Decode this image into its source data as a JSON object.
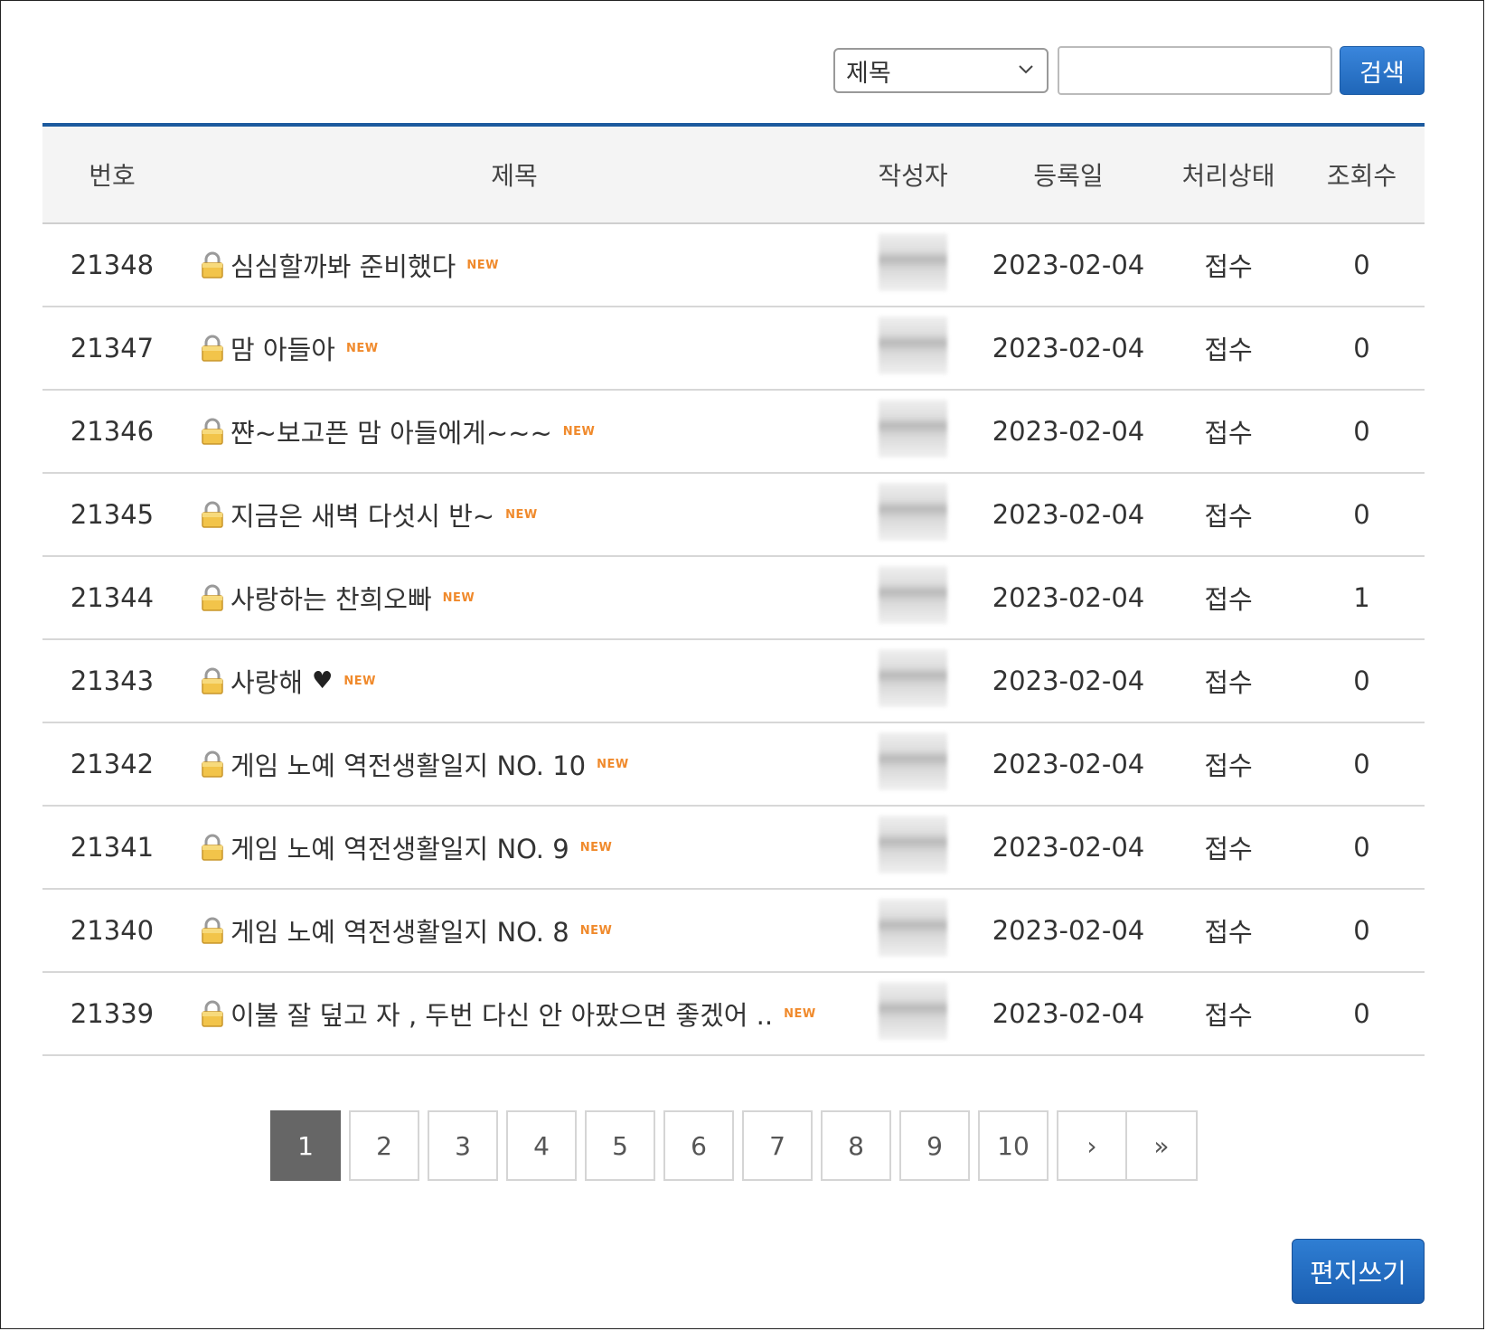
{
  "search": {
    "field_selected": "제목",
    "query": "",
    "button_label": "검색"
  },
  "table": {
    "headers": {
      "num": "번호",
      "title": "제목",
      "writer": "작성자",
      "date": "등록일",
      "status": "처리상태",
      "views": "조회수"
    },
    "rows": [
      {
        "num": "21348",
        "title": "심심할까봐 준비했다",
        "badge": "NEW",
        "date": "2023-02-04",
        "status": "접수",
        "views": "0"
      },
      {
        "num": "21347",
        "title": "맘 아들아",
        "badge": "NEW",
        "date": "2023-02-04",
        "status": "접수",
        "views": "0"
      },
      {
        "num": "21346",
        "title": "쨘~보고픈 맘 아들에게~~~",
        "badge": "NEW",
        "date": "2023-02-04",
        "status": "접수",
        "views": "0"
      },
      {
        "num": "21345",
        "title": "지금은 새벽 다섯시 반~",
        "badge": "NEW",
        "date": "2023-02-04",
        "status": "접수",
        "views": "0"
      },
      {
        "num": "21344",
        "title": "사랑하는 찬희오빠",
        "badge": "NEW",
        "date": "2023-02-04",
        "status": "접수",
        "views": "1"
      },
      {
        "num": "21343",
        "title": "사랑해",
        "heart": "♥",
        "badge": "NEW",
        "date": "2023-02-04",
        "status": "접수",
        "views": "0"
      },
      {
        "num": "21342",
        "title": "게임 노예 역전생활일지 NO. 10",
        "badge": "NEW",
        "date": "2023-02-04",
        "status": "접수",
        "views": "0"
      },
      {
        "num": "21341",
        "title": "게임 노예 역전생활일지 NO. 9",
        "badge": "NEW",
        "date": "2023-02-04",
        "status": "접수",
        "views": "0"
      },
      {
        "num": "21340",
        "title": "게임 노예 역전생활일지 NO. 8",
        "badge": "NEW",
        "date": "2023-02-04",
        "status": "접수",
        "views": "0"
      },
      {
        "num": "21339",
        "title": "이불 잘 덮고 자 , 두번 다신 안 아팠으면 좋겠어 ..",
        "badge": "NEW",
        "date": "2023-02-04",
        "status": "접수",
        "views": "0"
      }
    ]
  },
  "pagination": {
    "pages": [
      "1",
      "2",
      "3",
      "4",
      "5",
      "6",
      "7",
      "8",
      "9",
      "10"
    ],
    "current": "1",
    "next_symbol": "›",
    "last_symbol": "»"
  },
  "write_button_label": "편지쓰기",
  "icons": {
    "row_icon": "lock-icon",
    "select_arrow": "chevron-down-icon"
  },
  "colors": {
    "accent": "#1c5a9e",
    "button": "#2a74c8",
    "new_badge": "#f08a2c",
    "active_page": "#666666"
  }
}
